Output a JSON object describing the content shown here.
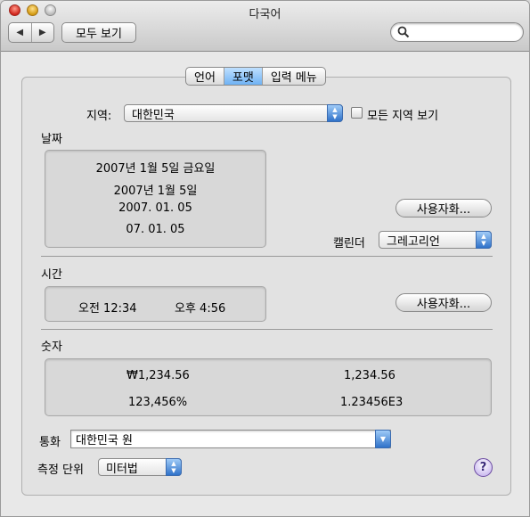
{
  "window": {
    "title": "다국어"
  },
  "toolbar": {
    "back_glyph": "◀",
    "forward_glyph": "▶",
    "show_all_label": "모두 보기",
    "search_placeholder": ""
  },
  "tabs": [
    {
      "label": "언어",
      "active": false
    },
    {
      "label": "포맷",
      "active": true
    },
    {
      "label": "입력 메뉴",
      "active": false
    }
  ],
  "region": {
    "label": "지역:",
    "value": "대한민국",
    "show_all_checkbox_label": "모든 지역 보기",
    "show_all_checked": false
  },
  "dates": {
    "section_label": "날짜",
    "examples": [
      "2007년 1월 5일 금요일",
      "2007년 1월 5일",
      "2007. 01. 05",
      "07. 01. 05"
    ],
    "customize_label": "사용자화...",
    "calendar_label": "캘린더",
    "calendar_value": "그레고리언"
  },
  "times": {
    "section_label": "시간",
    "examples": [
      "오전 12:34",
      "오후 4:56"
    ],
    "customize_label": "사용자화..."
  },
  "numbers": {
    "section_label": "숫자",
    "examples": [
      "₩1,234.56",
      "1,234.56",
      "123,456%",
      "1.23456E3"
    ]
  },
  "currency": {
    "label": "통화",
    "value": "대한민국 원"
  },
  "measurement": {
    "label": "측정 단위",
    "value": "미터법"
  },
  "help_label": "?",
  "colors": {
    "accent": "#2f72c9",
    "tab_active": "#8cc3f8"
  }
}
